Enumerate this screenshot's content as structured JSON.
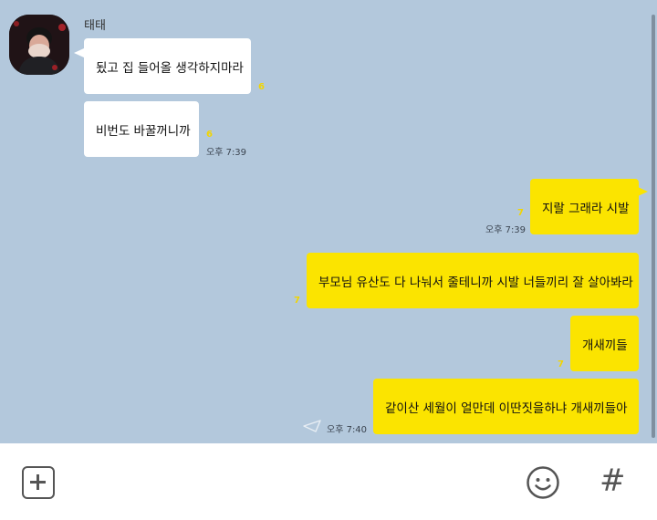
{
  "colors": {
    "chat_background": "#b3c8dc",
    "incoming_bubble": "#ffffff",
    "outgoing_bubble": "#fbe400",
    "read_count": "#f2d500"
  },
  "contact": {
    "name": "태태"
  },
  "messages": [
    {
      "direction": "incoming",
      "text": "됬고 집 들어올 생각하지마라",
      "unread": "6"
    },
    {
      "direction": "incoming",
      "text": "비번도 바꿀꺼니까",
      "unread": "6",
      "time": "오후 7:39"
    },
    {
      "direction": "outgoing",
      "text": "지랄 그래라 시발",
      "unread": "7",
      "time": "오후 7:39"
    },
    {
      "direction": "outgoing",
      "text": "부모님 유산도 다 나눠서 줄테니까 시발 너들끼리 잘 살아봐라",
      "unread": "7"
    },
    {
      "direction": "outgoing",
      "text": "개새끼들",
      "unread": "7"
    },
    {
      "direction": "outgoing",
      "text": "같이산 세월이 얼만데 이딴짓을하냐 개새끼들아",
      "time": "오후 7:40",
      "status_icon": "send-arrow-icon"
    }
  ],
  "input_bar": {
    "left_icon": "plus-icon",
    "right_icons": [
      "emoji-icon",
      "hash-icon"
    ],
    "hash_glyph": "#"
  }
}
